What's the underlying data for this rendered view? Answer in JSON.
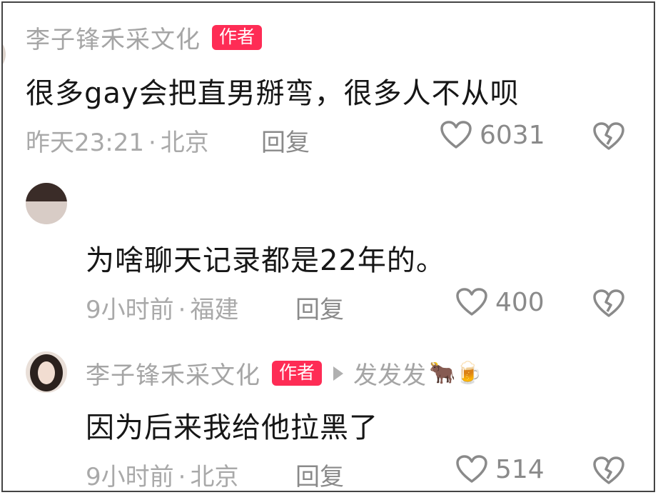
{
  "comments": [
    {
      "username": "李子锋禾采文化",
      "badge": "作者",
      "text": "很多gay会把直男掰弯，很多人不从呗",
      "time": "昨天23:21",
      "location": "北京",
      "reply_label": "回复",
      "likes": "6031"
    },
    {
      "text": "为啥聊天记录都是22年的。",
      "time": "9小时前",
      "location": "福建",
      "reply_label": "回复",
      "likes": "400"
    },
    {
      "username": "李子锋禾采文化",
      "badge": "作者",
      "reply_to": "发发发",
      "reply_to_emoji": "🐂🍺",
      "text": "因为后来我给他拉黑了",
      "time": "9小时前",
      "location": "北京",
      "reply_label": "回复",
      "likes": "514"
    }
  ],
  "separator": "·",
  "colors": {
    "badge": "#fe2c55",
    "meta_text": "#a9a9a9",
    "icon": "#8a8a8a"
  },
  "icons": {
    "like": "heart-outline-icon",
    "dislike": "broken-heart-icon",
    "reply_indicator": "triangle-right-icon"
  }
}
